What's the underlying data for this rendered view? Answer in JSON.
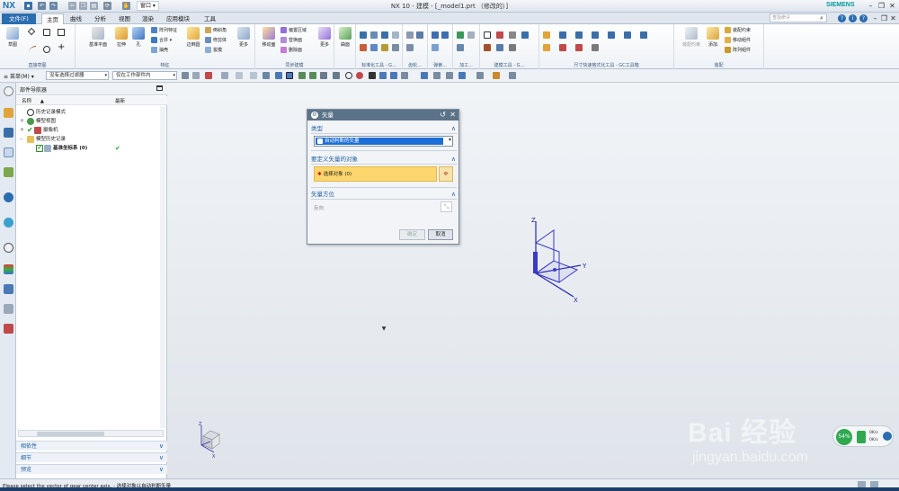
{
  "app": {
    "logo": "NX",
    "title": "NX 10 - 建模 - [_model1.prt （修改的）]",
    "brand": "SIEMENS",
    "window_menu": "窗口",
    "accent": "#2a6db0"
  },
  "tabs": [
    {
      "label": "文件(F)"
    },
    {
      "label": "主页"
    },
    {
      "label": "曲线"
    },
    {
      "label": "分析"
    },
    {
      "label": "视图"
    },
    {
      "label": "渲染"
    },
    {
      "label": "应用模块"
    },
    {
      "label": "工具"
    }
  ],
  "search": {
    "placeholder": "查找命令"
  },
  "ribbon": {
    "sketch": "草图",
    "datum_plane": "基准平面",
    "extrude": "拉伸",
    "hole": "孔",
    "array_feature": "阵列特征",
    "combine": "合并",
    "shell": "抽壳",
    "edge_blend": "边倒圆",
    "chamfer": "倒斜角",
    "trim_body": "修剪体",
    "draft": "拔模",
    "more": "更多",
    "move_face": "移动面",
    "offset_region": "偏置区域",
    "replace_face": "替换面",
    "delete_face": "删除面",
    "surface": "曲面",
    "assembly_constraint": "装配约束",
    "add": "添加",
    "assemble": "装配约束",
    "move_component": "移动组件",
    "array_component": "阵列组件",
    "groups": {
      "direct_sketch": "直接草图",
      "feature": "特征",
      "sync_modeling": "同步建模",
      "std_tools": "标准化工具 - G...",
      "gear": "齿轮...",
      "spring": "弹簧...",
      "machining": "加工...",
      "build_tools": "建模工具 - G...",
      "dim_tools": "尺寸快速格式化工具 - GC工具箱",
      "assembly": "装配"
    }
  },
  "selection_bar": {
    "menu": "菜单(M)",
    "filter": "没有选择过滤器",
    "scope": "仅在工作部件内"
  },
  "navigator": {
    "title": "部件导航器",
    "col_name": "名称",
    "col_latest": "最新",
    "items": [
      {
        "label": "历史记录模式"
      },
      {
        "label": "模型视图"
      },
      {
        "label": "摄像机"
      },
      {
        "label": "模型历史记录"
      },
      {
        "label": "基准坐标系 (0)",
        "check": "✔"
      }
    ],
    "panels": [
      "相依性",
      "细节",
      "预览"
    ]
  },
  "dialog": {
    "title": "矢量",
    "section_type": "类型",
    "type_value": "自动判断的矢量",
    "section_object": "要定义矢量的对象",
    "select_object": "选择对象 (0)",
    "section_orientation": "矢量方位",
    "reverse": "反向",
    "ok": "确定",
    "cancel": "取消"
  },
  "axes": {
    "x": "X",
    "y": "Y",
    "z": "Z"
  },
  "status": {
    "text": "Please select the vector of gear center axis. - 选择对象以自动判断矢量"
  },
  "net_monitor": {
    "percent": "54%",
    "up": "0K/s",
    "down": "0K/s"
  },
  "watermark": {
    "text": "Bai 经验",
    "url": "jingyan.baidu.com"
  }
}
